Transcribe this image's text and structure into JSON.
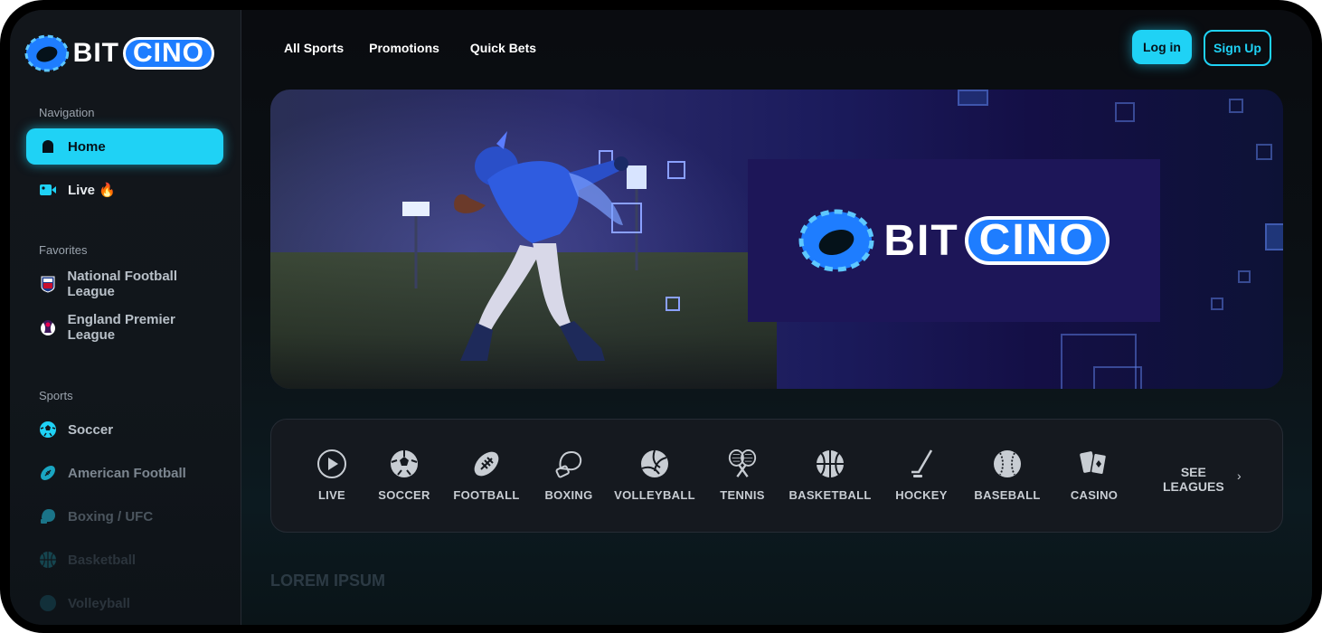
{
  "app": {
    "logo_part1": "BIT",
    "logo_part2": "CINO"
  },
  "colors": {
    "accent": "#1fd2f5",
    "brand_blue": "#1e7dff",
    "sidebar_bg": "#12161b"
  },
  "sidebar": {
    "navigation_title": "Navigation",
    "navigation": [
      {
        "label": "Home",
        "icon": "home-icon",
        "active": true
      },
      {
        "label": "Live 🔥",
        "icon": "live-video-icon",
        "active": false
      }
    ],
    "favorites_title": "Favorites",
    "favorites": [
      {
        "label": "National Football League",
        "icon": "nfl-icon"
      },
      {
        "label": "England Premier League",
        "icon": "premier-league-icon"
      }
    ],
    "sports_title": "Sports",
    "sports": [
      {
        "label": "Soccer",
        "icon": "soccer-icon"
      },
      {
        "label": "American Football",
        "icon": "football-icon"
      },
      {
        "label": "Boxing / UFC",
        "icon": "boxing-icon"
      },
      {
        "label": "Basketball",
        "icon": "basketball-icon"
      },
      {
        "label": "Volleyball",
        "icon": "volleyball-icon"
      }
    ]
  },
  "header": {
    "nav": [
      "All Sports",
      "Promotions",
      "Quick Bets"
    ],
    "login_label": "Log in",
    "signup_label": "Sign Up"
  },
  "banner": {
    "logo_part1": "BIT",
    "logo_part2": "CINO"
  },
  "sports_strip": {
    "items": [
      {
        "label": "LIVE",
        "icon": "play-icon"
      },
      {
        "label": "SOCCER",
        "icon": "soccer-icon"
      },
      {
        "label": "FOOTBALL",
        "icon": "football-icon"
      },
      {
        "label": "BOXING",
        "icon": "boxing-glove-icon"
      },
      {
        "label": "VOLLEYBALL",
        "icon": "volleyball-icon"
      },
      {
        "label": "TENNIS",
        "icon": "tennis-icon"
      },
      {
        "label": "BASKETBALL",
        "icon": "basketball-icon"
      },
      {
        "label": "HOCKEY",
        "icon": "hockey-icon"
      },
      {
        "label": "BASEBALL",
        "icon": "baseball-icon"
      },
      {
        "label": "CASINO",
        "icon": "cards-icon"
      }
    ],
    "see_leagues_line1": "SEE",
    "see_leagues_line2": "LEAGUES"
  },
  "main": {
    "section_heading": "LOREM IPSUM"
  }
}
